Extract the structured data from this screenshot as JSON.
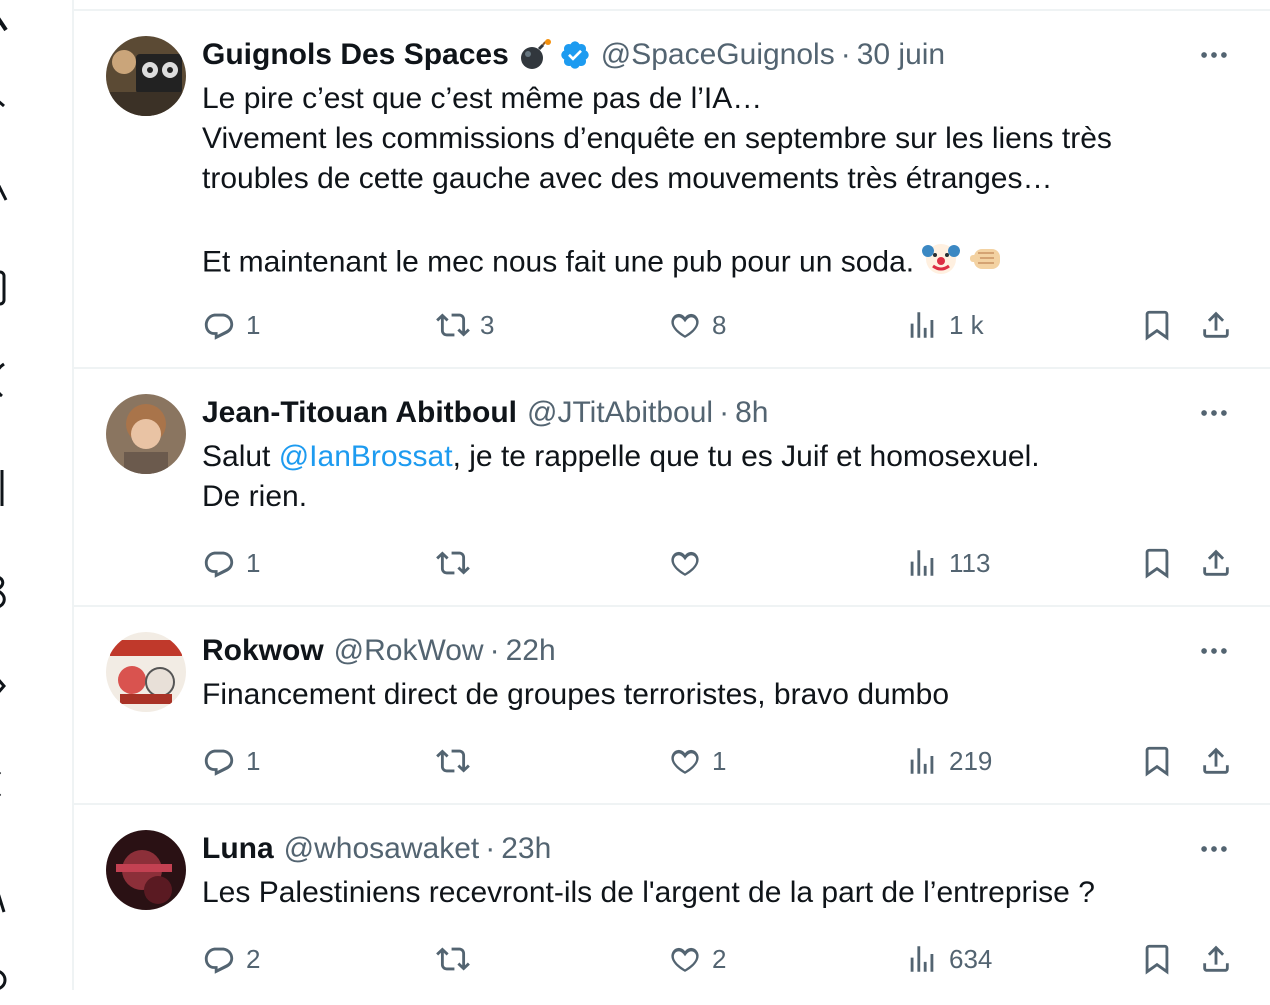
{
  "colors": {
    "text": "#0f1419",
    "muted": "#536471",
    "link": "#1d9bf0",
    "border": "#eff3f4",
    "verified": "#1d9bf0"
  },
  "tweets": [
    {
      "name": "Guignols Des Spaces",
      "name_emoji": "bomb-icon",
      "verified": true,
      "handle": "@SpaceGuignols",
      "separator": "·",
      "time": "30 juin",
      "lines": [
        "Le pire c’est que c’est même pas de l’IA…",
        "Vivement les commissions d’enquête en septembre sur les liens très",
        "troubles de cette gauche avec des mouvements très étranges…",
        "",
        "Et maintenant le mec nous fait une pub pour un soda."
      ],
      "trailing_emojis": [
        "clown-face-icon",
        "pointing-fist-icon"
      ],
      "replies": "1",
      "retweets": "3",
      "likes": "8",
      "views": "1 k"
    },
    {
      "name": "Jean-Titouan Abitboul",
      "handle": "@JTitAbitboul",
      "separator": "·",
      "time": "8h",
      "line1_prefix": "Salut ",
      "mention": "@IanBrossat",
      "line1_suffix": ", je te rappelle que tu es Juif et homosexuel.",
      "line2": "De rien.",
      "replies": "1",
      "retweets": "",
      "likes": "",
      "views": "113"
    },
    {
      "name": "Rokwow",
      "handle": "@RokWow",
      "separator": "·",
      "time": "22h",
      "line1": "Financement direct de groupes terroristes, bravo dumbo",
      "replies": "1",
      "retweets": "",
      "likes": "1",
      "views": "219"
    },
    {
      "name": "Luna",
      "handle": "@whosawaket",
      "separator": "·",
      "time": "23h",
      "line1": "Les Palestiniens recevront-ils de l'argent de la part de l’entreprise ?",
      "replies": "2",
      "retweets": "",
      "likes": "2",
      "views": "634"
    }
  ]
}
